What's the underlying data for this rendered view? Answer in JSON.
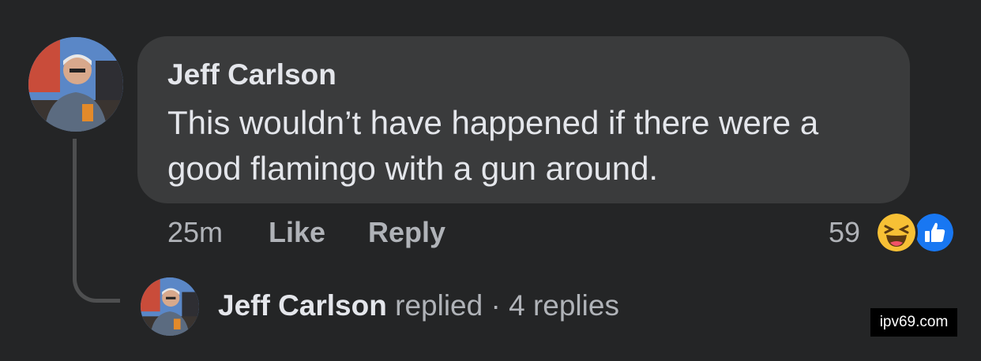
{
  "comment": {
    "author": "Jeff Carlson",
    "text": "This wouldn’t have happened if there were a good flamingo with a gun around.",
    "time": "25m",
    "like_label": "Like",
    "reply_label": "Reply",
    "reaction_count": "59",
    "reactions": [
      "haha-reaction-icon",
      "like-reaction-icon"
    ]
  },
  "replies": {
    "author": "Jeff Carlson",
    "action": "replied",
    "separator": "·",
    "count": "4 replies"
  },
  "watermark": "ipv69.com",
  "colors": {
    "background": "#242526",
    "bubble": "#3a3b3c",
    "primary_text": "#e4e6eb",
    "secondary_text": "#b0b3b8",
    "like_blue": "#1877f2",
    "haha_yellow": "#f7c035"
  }
}
